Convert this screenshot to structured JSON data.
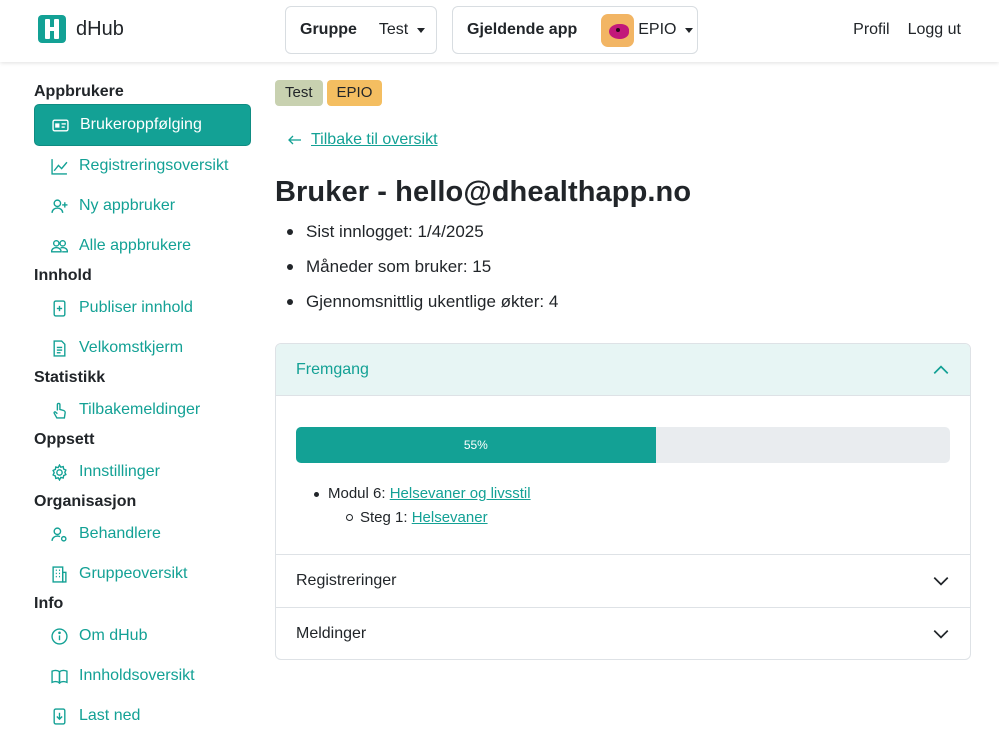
{
  "brand": {
    "name": "dHub"
  },
  "header": {
    "group_label": "Gruppe",
    "group_value": "Test",
    "app_label": "Gjeldende app",
    "app_value": "EPIO",
    "profile": "Profil",
    "logout": "Logg ut"
  },
  "sidebar": {
    "sections": [
      {
        "title": "Appbrukere",
        "items": [
          "Brukeroppfølging",
          "Registreringsoversikt",
          "Ny appbruker",
          "Alle appbrukere"
        ]
      },
      {
        "title": "Innhold",
        "items": [
          "Publiser innhold",
          "Velkomstkjerm"
        ]
      },
      {
        "title": "Statistikk",
        "items": [
          "Tilbakemeldinger"
        ]
      },
      {
        "title": "Oppsett",
        "items": [
          "Innstillinger"
        ]
      },
      {
        "title": "Organisasjon",
        "items": [
          "Behandlere",
          "Gruppeoversikt"
        ]
      },
      {
        "title": "Info",
        "items": [
          "Om dHub",
          "Innholdsoversikt",
          "Last ned"
        ]
      }
    ]
  },
  "main": {
    "badges": [
      "Test",
      "EPIO"
    ],
    "back_link": "Tilbake til oversikt",
    "title": "Bruker - hello@dhealthapp.no",
    "stats": [
      "Sist innlogget: 1/4/2025",
      "Måneder som bruker: 15",
      "Gjennomsnittlig ukentlige økter: 4"
    ],
    "accordion": {
      "progress_title": "Fremgang",
      "progress_value": 55,
      "progress_label": "55%",
      "module_prefix": "Modul 6: ",
      "module_link": "Helsevaner og livsstil",
      "step_prefix": "Steg 1: ",
      "step_link": "Helsevaner",
      "registrations_title": "Registreringer",
      "messages_title": "Meldinger"
    }
  },
  "colors": {
    "accent": "#13a195",
    "badge_test": "#c8d1b0",
    "badge_epio": "#f4be61"
  }
}
